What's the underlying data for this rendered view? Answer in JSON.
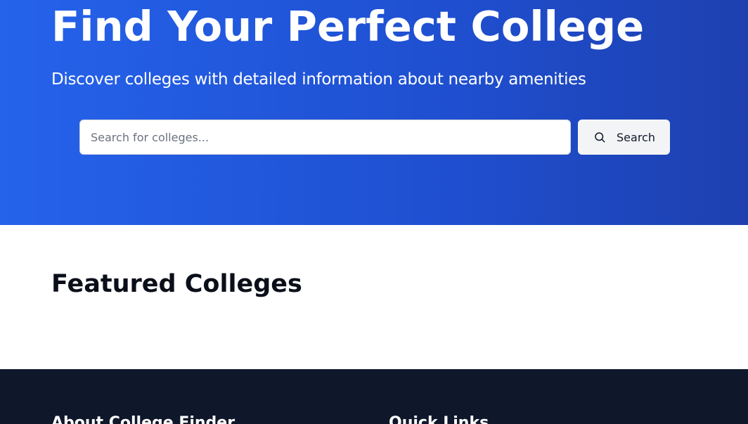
{
  "hero": {
    "title": "Find Your Perfect College",
    "subtitle": "Discover colleges with detailed information about nearby amenities",
    "gradient_colors": [
      "#2563eb",
      "#1e40af"
    ]
  },
  "search": {
    "placeholder": "Search for colleges...",
    "value": "",
    "button_label": "Search",
    "button_icon": "search-icon"
  },
  "featured": {
    "title": "Featured Colleges"
  },
  "footer": {
    "background": "#0f172a",
    "about_heading": "About College Finder",
    "quick_links_heading": "Quick Links"
  }
}
